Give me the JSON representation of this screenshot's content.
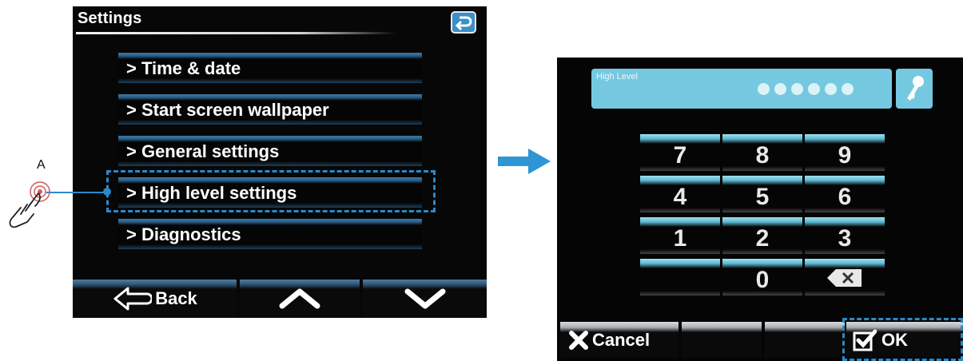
{
  "left_screen": {
    "title": "Settings",
    "menu_items": [
      {
        "label": "> Time & date"
      },
      {
        "label": "> Start screen wallpaper"
      },
      {
        "label": "> General settings"
      },
      {
        "label": "> High level settings"
      },
      {
        "label": "> Diagnostics"
      }
    ],
    "bottom_bar": {
      "back_label": "Back"
    }
  },
  "callout": {
    "label": "A"
  },
  "right_screen": {
    "pin_field_label": "High Level",
    "pin_digits_entered": 6,
    "keypad": [
      "7",
      "8",
      "9",
      "4",
      "5",
      "6",
      "1",
      "2",
      "3",
      "0"
    ],
    "cancel_label": "Cancel",
    "ok_label": "OK"
  },
  "colors": {
    "accent": "#2a89c9",
    "menu_bar": "#3b79a7",
    "pin_field": "#74c9e0"
  },
  "icons": [
    "return-icon",
    "back-arrow-icon",
    "chevron-up-icon",
    "chevron-down-icon",
    "hand-tap-icon",
    "right-arrow-icon",
    "key-icon",
    "backspace-icon",
    "x-icon",
    "checkbox-check-icon"
  ]
}
